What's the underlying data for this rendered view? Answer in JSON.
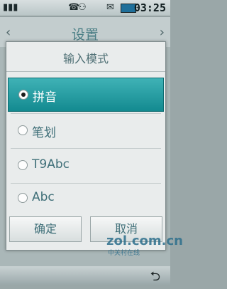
{
  "status_bar": {
    "time": "03:25"
  },
  "background_screen": {
    "title": "设置"
  },
  "dialog": {
    "title": "输入模式",
    "options": [
      {
        "label": "拼音",
        "selected": true
      },
      {
        "label": "笔划",
        "selected": false
      },
      {
        "label": "T9Abc",
        "selected": false
      },
      {
        "label": "Abc",
        "selected": false
      }
    ],
    "ok_label": "确定",
    "cancel_label": "取消"
  },
  "watermark": {
    "text": "zol.com.cn",
    "sub": "中关村在线"
  },
  "colors": {
    "selected_bg": "#1f9aa0",
    "label_text": "#3f6f78"
  }
}
